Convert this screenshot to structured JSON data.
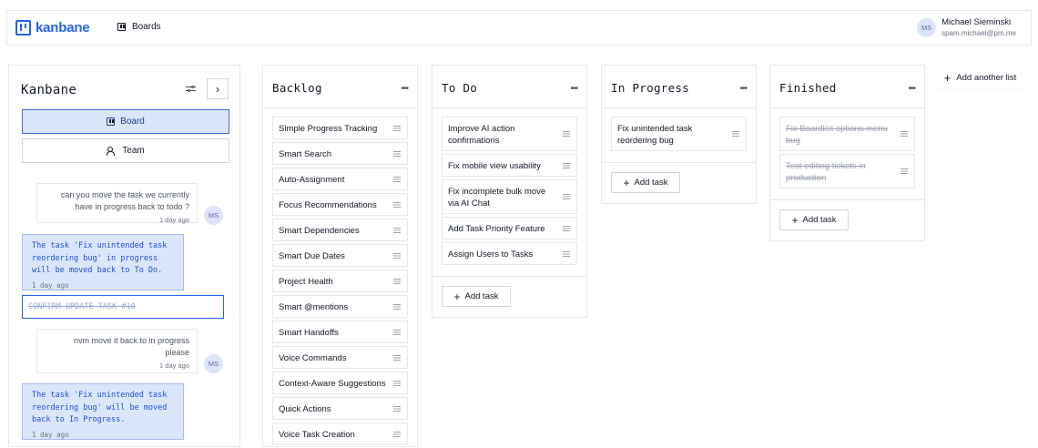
{
  "app": {
    "name": "kanbane"
  },
  "header": {
    "nav_boards": "Boards",
    "user": {
      "initials": "MS",
      "name": "Michael Sieminski",
      "email": "spam.michael@pm.me"
    }
  },
  "chat": {
    "title": "Kanbane",
    "tabs": [
      {
        "label": "Board",
        "active": true,
        "icon": "board-icon"
      },
      {
        "label": "Team",
        "active": false,
        "icon": "team-icon"
      }
    ],
    "messages": [
      {
        "role": "user",
        "text": "can you move the task we currently have in progress back to todo ?",
        "time": "1 day ago"
      },
      {
        "role": "assistant",
        "text": "The task 'Fix unintended task reordering bug' in progress will be moved back to To Do.",
        "time": "1 day ago"
      },
      {
        "role": "action",
        "text": "CONFIRM UPDATE TASK #10"
      },
      {
        "role": "user",
        "text": "nvm move it back to in progress please",
        "time": "1 day ago"
      },
      {
        "role": "assistant",
        "text": "The task 'Fix unintended task reordering bug' will be moved back to In Progress.",
        "time": "1 day ago"
      }
    ]
  },
  "board": {
    "add_task_label": "Add task",
    "add_list_label": "Add another list",
    "columns": [
      {
        "title": "Backlog",
        "tasks": [
          "Simple Progress Tracking",
          "Smart Search",
          "Auto-Assignment",
          "Focus Recommendations",
          "Smart Dependencies",
          "Smart Due Dates",
          "Project Health",
          "Smart @mentions",
          "Smart Handoffs",
          "Voice Commands",
          "Context-Aware Suggestions",
          "Quick Actions",
          "Voice Task Creation"
        ]
      },
      {
        "title": "To Do",
        "tasks": [
          "Improve AI action confirmations",
          "Fix mobile view usability",
          "Fix incomplete bulk move via AI Chat",
          "Add Task Priority Feature",
          "Assign Users to Tasks"
        ]
      },
      {
        "title": "In Progress",
        "tasks": [
          "Fix unintended task reordering bug"
        ]
      },
      {
        "title": "Finished",
        "tasks": [
          "Fix Boardlist options menu bug",
          "Test editing tickets in production"
        ]
      }
    ]
  },
  "colors": {
    "brand": "#2563eb",
    "active_tab_bg": "#dbe6fb",
    "bot_text": "#1d4ed8"
  }
}
